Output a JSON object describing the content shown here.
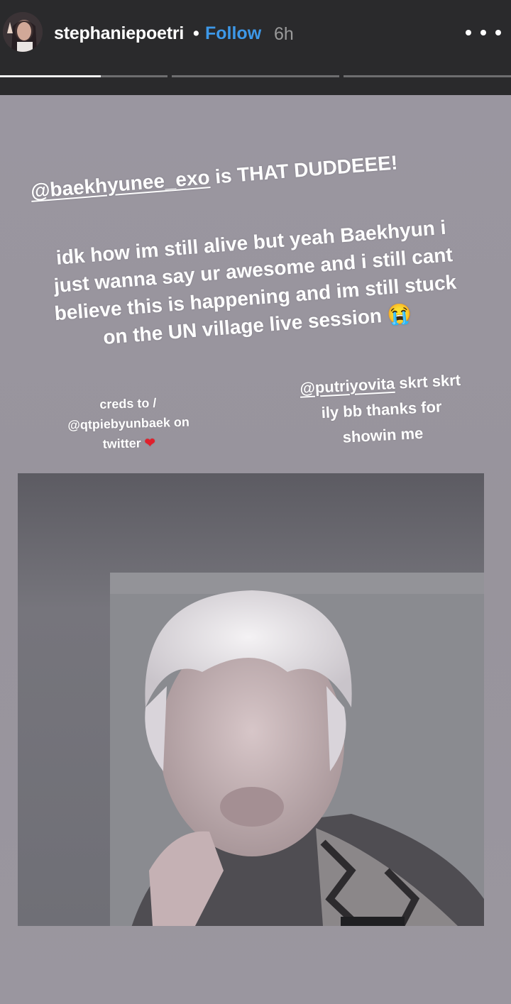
{
  "header": {
    "username": "stephaniepoetri",
    "separator": "•",
    "follow_label": "Follow",
    "time_ago": "6h",
    "more_icon": "more-horizontal-icon"
  },
  "progress": {
    "segments": 3,
    "current_segment": 1,
    "current_fraction": 0.6
  },
  "story": {
    "headline_mention": "@baekhyunee_exo",
    "headline_text": " is THAT DUDDEEE!",
    "paragraph": [
      "idk how im still alive but yeah Baekhyun i",
      "just wanna say ur awesome and i still cant",
      "believe this is happening and im still stuck",
      "on the UN village live session"
    ],
    "paragraph_emoji": "😭",
    "credits": [
      "creds to /",
      "@qtpiebyunbaek on",
      "twitter"
    ],
    "credits_emoji": "❤",
    "thanks_mention": "@putriyovita",
    "thanks_lines": [
      " skrt skrt",
      "ily bb thanks for",
      "showin me"
    ]
  },
  "colors": {
    "header_bg": "#2a2a2c",
    "follow": "#3d98e8",
    "story_bg": "#99959d"
  }
}
